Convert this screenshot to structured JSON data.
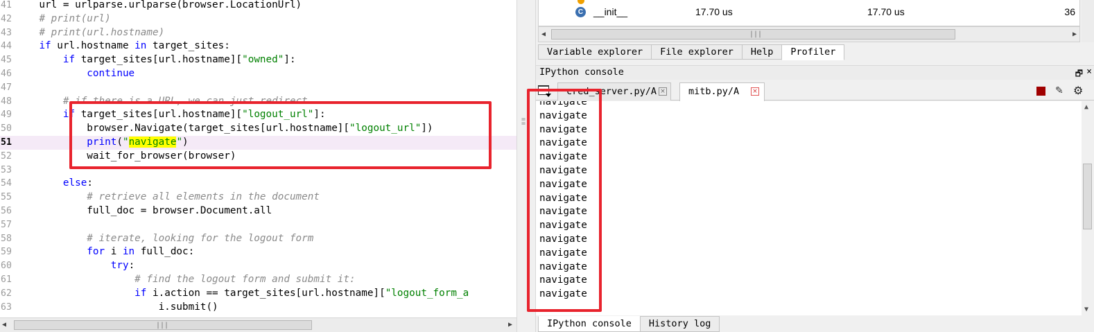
{
  "editor": {
    "lines": [
      {
        "num": "41",
        "segments": [
          {
            "t": "    url = urlparse.urlparse(browser.LocationUrl)",
            "c": ""
          }
        ]
      },
      {
        "num": "42",
        "segments": [
          {
            "t": "    ",
            "c": ""
          },
          {
            "t": "# print(url)",
            "c": "cm"
          }
        ]
      },
      {
        "num": "43",
        "segments": [
          {
            "t": "    ",
            "c": ""
          },
          {
            "t": "# print(url.hostname)",
            "c": "cm"
          }
        ]
      },
      {
        "num": "44",
        "segments": [
          {
            "t": "    ",
            "c": ""
          },
          {
            "t": "if",
            "c": "kw"
          },
          {
            "t": " url.hostname ",
            "c": ""
          },
          {
            "t": "in",
            "c": "kw"
          },
          {
            "t": " target_sites:",
            "c": ""
          }
        ]
      },
      {
        "num": "45",
        "segments": [
          {
            "t": "        ",
            "c": ""
          },
          {
            "t": "if",
            "c": "kw"
          },
          {
            "t": " target_sites[url.hostname][",
            "c": ""
          },
          {
            "t": "\"owned\"",
            "c": "st"
          },
          {
            "t": "]:",
            "c": ""
          }
        ]
      },
      {
        "num": "46",
        "segments": [
          {
            "t": "            ",
            "c": ""
          },
          {
            "t": "continue",
            "c": "kw"
          }
        ]
      },
      {
        "num": "47",
        "segments": [
          {
            "t": "",
            "c": ""
          }
        ]
      },
      {
        "num": "48",
        "segments": [
          {
            "t": "        ",
            "c": ""
          },
          {
            "t": "# if there is a URL, we can just redirect",
            "c": "cm"
          }
        ]
      },
      {
        "num": "49",
        "segments": [
          {
            "t": "        ",
            "c": ""
          },
          {
            "t": "if",
            "c": "kw"
          },
          {
            "t": " target_sites[url.hostname][",
            "c": ""
          },
          {
            "t": "\"logout_url\"",
            "c": "st"
          },
          {
            "t": "]:",
            "c": ""
          }
        ]
      },
      {
        "num": "50",
        "segments": [
          {
            "t": "            browser.Navigate(target_sites[url.hostname][",
            "c": ""
          },
          {
            "t": "\"logout_url\"",
            "c": "st"
          },
          {
            "t": "])",
            "c": ""
          }
        ]
      },
      {
        "num": "51",
        "current": true,
        "segments": [
          {
            "t": "            ",
            "c": ""
          },
          {
            "t": "print",
            "c": "kw"
          },
          {
            "t": "(",
            "c": ""
          },
          {
            "t": "\"",
            "c": "st"
          },
          {
            "t": "navigate",
            "c": "st hl"
          },
          {
            "t": "\"",
            "c": "st"
          },
          {
            "t": ")",
            "c": ""
          }
        ]
      },
      {
        "num": "52",
        "segments": [
          {
            "t": "            wait_for_browser(browser)",
            "c": ""
          }
        ]
      },
      {
        "num": "53",
        "segments": [
          {
            "t": "",
            "c": ""
          }
        ]
      },
      {
        "num": "54",
        "segments": [
          {
            "t": "        ",
            "c": ""
          },
          {
            "t": "else",
            "c": "kw"
          },
          {
            "t": ":",
            "c": ""
          }
        ]
      },
      {
        "num": "55",
        "segments": [
          {
            "t": "            ",
            "c": ""
          },
          {
            "t": "# retrieve all elements in the document",
            "c": "cm"
          }
        ]
      },
      {
        "num": "56",
        "segments": [
          {
            "t": "            full_doc = browser.Document.all",
            "c": ""
          }
        ]
      },
      {
        "num": "57",
        "segments": [
          {
            "t": "",
            "c": ""
          }
        ]
      },
      {
        "num": "58",
        "segments": [
          {
            "t": "            ",
            "c": ""
          },
          {
            "t": "# iterate, looking for the logout form",
            "c": "cm"
          }
        ]
      },
      {
        "num": "59",
        "segments": [
          {
            "t": "            ",
            "c": ""
          },
          {
            "t": "for",
            "c": "kw"
          },
          {
            "t": " i ",
            "c": ""
          },
          {
            "t": "in",
            "c": "kw"
          },
          {
            "t": " full_doc:",
            "c": ""
          }
        ]
      },
      {
        "num": "60",
        "segments": [
          {
            "t": "                ",
            "c": ""
          },
          {
            "t": "try",
            "c": "kw"
          },
          {
            "t": ":",
            "c": ""
          }
        ]
      },
      {
        "num": "61",
        "segments": [
          {
            "t": "                    ",
            "c": ""
          },
          {
            "t": "# find the logout form and submit it:",
            "c": "cm"
          }
        ]
      },
      {
        "num": "62",
        "segments": [
          {
            "t": "                    ",
            "c": ""
          },
          {
            "t": "if",
            "c": "kw"
          },
          {
            "t": " i.action == target_sites[url.hostname][",
            "c": ""
          },
          {
            "t": "\"logout_form_a",
            "c": "st"
          }
        ]
      },
      {
        "num": "63",
        "segments": [
          {
            "t": "                        i.submit()",
            "c": ""
          }
        ]
      }
    ]
  },
  "profiler": {
    "row": {
      "icon_letter": "C",
      "function": "__init__",
      "total_time": "17.70 us",
      "local_time": "17.70 us",
      "calls": "36"
    }
  },
  "pane_tabs": [
    {
      "label": "Variable explorer",
      "active": false
    },
    {
      "label": "File explorer",
      "active": false
    },
    {
      "label": "Help",
      "active": false
    },
    {
      "label": "Profiler",
      "active": true
    }
  ],
  "console": {
    "title": "IPython console",
    "undock_glyph": "🗗",
    "close_glyph": "×",
    "tabs": [
      {
        "label": "cred_server.py/A",
        "close_glyph": "×"
      },
      {
        "label": "mitb.py/A",
        "close_glyph": "×"
      }
    ],
    "output_lines": [
      "navigate",
      "navigate",
      "navigate",
      "navigate",
      "navigate",
      "navigate",
      "navigate",
      "navigate",
      "navigate",
      "navigate",
      "navigate",
      "navigate",
      "navigate",
      "navigate",
      "navigate"
    ]
  },
  "bottom_tabs": [
    {
      "label": "IPython console",
      "active": true
    },
    {
      "label": "History log",
      "active": false
    }
  ],
  "colors": {
    "annotation": "#e8232d",
    "keyword": "#0000ff",
    "string": "#008000",
    "comment": "#8a8a8a",
    "current_line": "#f5eaf7",
    "search_highlight": "#ffff00",
    "stop_button": "#a00000"
  },
  "icons": {
    "folder": "open-folder-icon",
    "stop": "stop-icon",
    "eraser": "eraser-icon",
    "gear": "gear-icon",
    "function": "function-icon"
  }
}
